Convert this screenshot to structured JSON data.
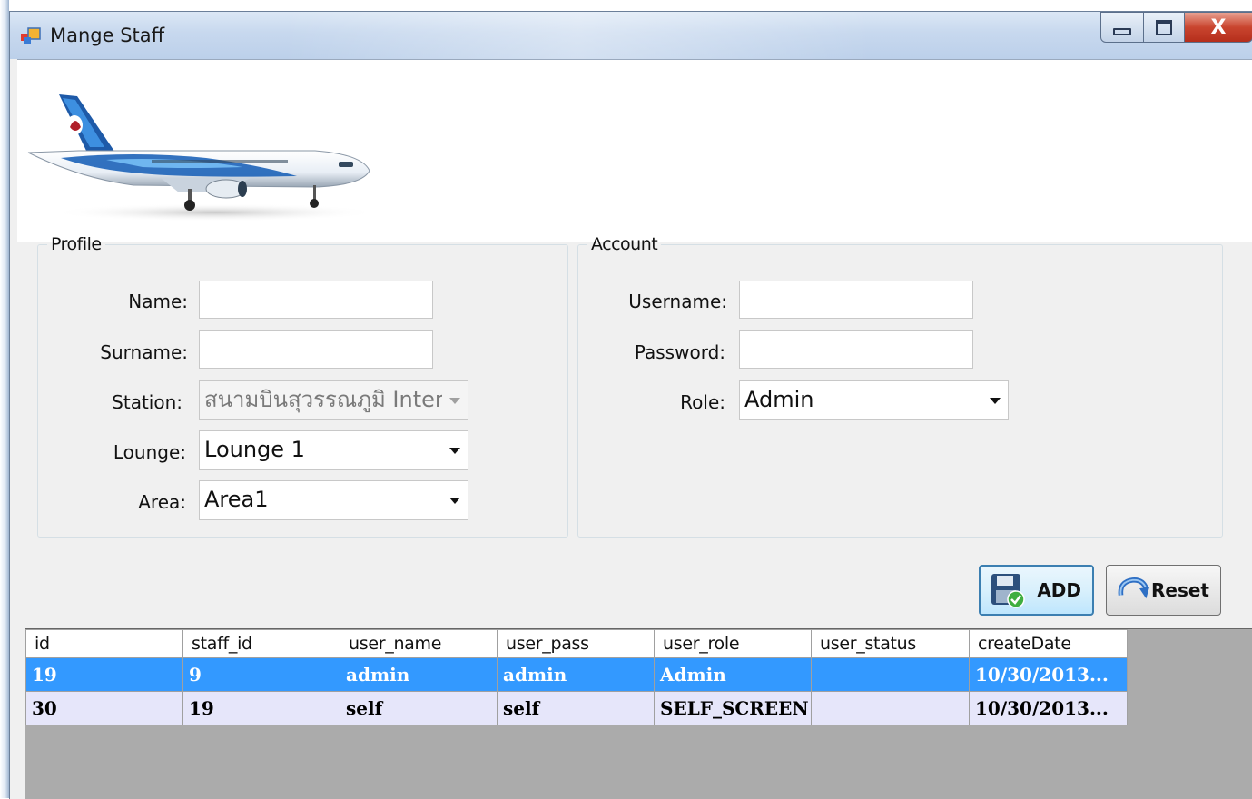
{
  "window": {
    "title": "Mange Staff",
    "minimize_symbol": "▭",
    "maximize_symbol": "▢",
    "close_symbol": "X"
  },
  "profile": {
    "legend": "Profile",
    "name_label": "Name:",
    "name_value": "",
    "surname_label": "Surname:",
    "surname_value": "",
    "station_label": "Station:",
    "station_value": "สนามบินสุวรรณภูมิ Inter",
    "station_enabled": false,
    "lounge_label": "Lounge:",
    "lounge_value": "Lounge 1",
    "area_label": "Area:",
    "area_value": "Area1"
  },
  "account": {
    "legend": "Account",
    "username_label": "Username:",
    "username_value": "",
    "password_label": "Password:",
    "password_value": "",
    "role_label": "Role:",
    "role_value": "Admin"
  },
  "buttons": {
    "add_label": "ADD",
    "add_icon": "floppy-disk-check-icon",
    "reset_label": "Reset",
    "reset_icon": "refresh-arrow-icon"
  },
  "grid": {
    "columns": [
      "id",
      "staff_id",
      "user_name",
      "user_pass",
      "user_role",
      "user_status",
      "createDate"
    ],
    "rows": [
      [
        "19",
        "9",
        "admin",
        "admin",
        "Admin",
        "",
        "10/30/2013..."
      ],
      [
        "30",
        "19",
        "self",
        "self",
        "SELF_SCREEN",
        "",
        "10/30/2013..."
      ]
    ],
    "selected_row": 0
  },
  "colors": {
    "selection": "#3399ff",
    "alt_row": "#e6e6fa",
    "grid_background": "#ababab",
    "close_button": "#c9452f"
  }
}
